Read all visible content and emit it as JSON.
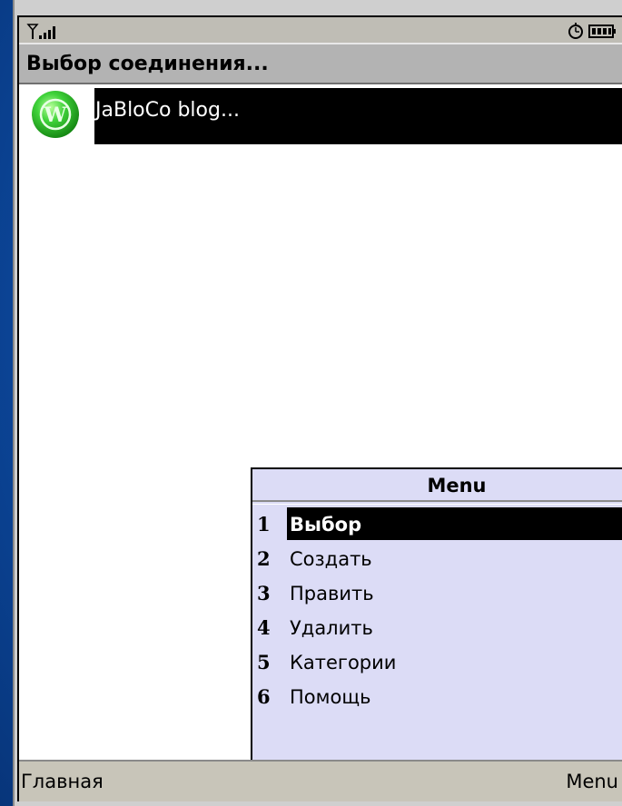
{
  "screen": {
    "title": "Выбор соединения...",
    "status_icons": [
      "signal-strength-icon",
      "alarm-clock-icon",
      "battery-icon"
    ]
  },
  "list": {
    "items": [
      {
        "label": "JaBloCo blog...",
        "icon": "wordpress-icon",
        "selected": true
      }
    ]
  },
  "menu": {
    "title": "Menu",
    "items": [
      {
        "num": "1",
        "label": "Выбор",
        "selected": true
      },
      {
        "num": "2",
        "label": "Создать"
      },
      {
        "num": "3",
        "label": "Править"
      },
      {
        "num": "4",
        "label": "Удалить"
      },
      {
        "num": "5",
        "label": "Категории"
      },
      {
        "num": "6",
        "label": "Помощь"
      }
    ]
  },
  "softkeys": {
    "left": "Главная",
    "right": "Menu"
  },
  "colors": {
    "selection": "#000000",
    "menu_background": "#dcdcf6",
    "titlebar": "#b3b3b3",
    "desktop": "#0e4ea8"
  }
}
